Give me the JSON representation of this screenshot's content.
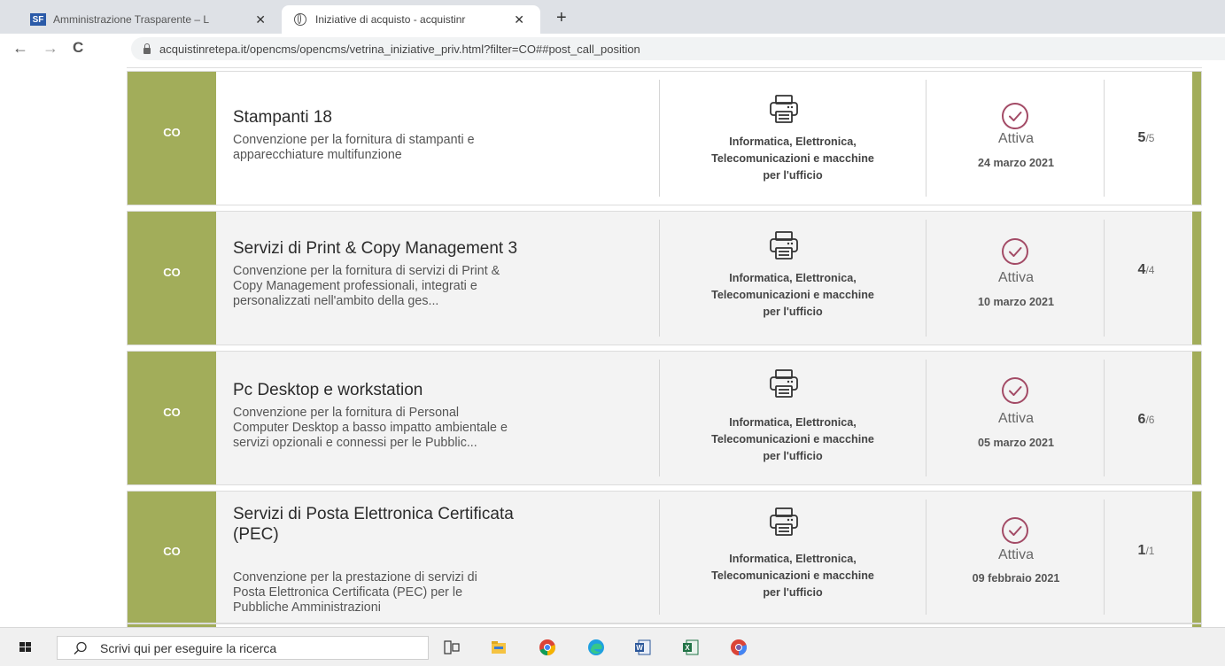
{
  "browser": {
    "tabs": [
      {
        "favicon": "SF",
        "label": "Amministrazione Trasparente – L"
      },
      {
        "favicon": "globe-icon",
        "label": "Iniziative di acquisto - acquistinr"
      }
    ],
    "tab_close": "✕",
    "new_tab": "+",
    "nav": {
      "back": "←",
      "forward": "→",
      "reload": "C"
    },
    "url": "acquistinretepa.it/opencms/opencms/vetrina_iniziative_priv.html?filter=CO##post_call_position"
  },
  "colors": {
    "accent": "#a2ad5a",
    "status_icon": "#a34b66"
  },
  "initiatives": [
    {
      "badge": "CO",
      "title_lines": [
        "Stampanti 18"
      ],
      "description_lines": [
        "Convenzione per la fornitura di stampanti e",
        "apparecchiature multifunzione"
      ],
      "category_icon": "printer-icon",
      "category_lines": [
        "Informatica, Elettronica,",
        "Telecomunicazioni e macchine",
        "per l'ufficio"
      ],
      "status_icon": "check-circle-icon",
      "status": "Attiva",
      "date": "24 marzo 2021",
      "lots_active": "5",
      "lots_total": "/5"
    },
    {
      "badge": "CO",
      "title_lines": [
        "Servizi di Print & Copy Management 3"
      ],
      "description_lines": [
        "Convenzione per la fornitura di servizi di Print &",
        "Copy Management professionali, integrati e",
        "personalizzati nell'ambito della ges..."
      ],
      "category_icon": "printer-icon",
      "category_lines": [
        "Informatica, Elettronica,",
        "Telecomunicazioni e macchine",
        "per l'ufficio"
      ],
      "status_icon": "check-circle-icon",
      "status": "Attiva",
      "date": "10 marzo 2021",
      "lots_active": "4",
      "lots_total": "/4"
    },
    {
      "badge": "CO",
      "title_lines": [
        "Pc Desktop e workstation"
      ],
      "description_lines": [
        "Convenzione per la fornitura di Personal",
        "Computer Desktop a basso impatto ambientale e",
        "servizi opzionali e connessi per le Pubblic..."
      ],
      "category_icon": "printer-icon",
      "category_lines": [
        "Informatica, Elettronica,",
        "Telecomunicazioni e macchine",
        "per l'ufficio"
      ],
      "status_icon": "check-circle-icon",
      "status": "Attiva",
      "date": "05 marzo 2021",
      "lots_active": "6",
      "lots_total": "/6"
    },
    {
      "badge": "CO",
      "title_lines": [
        "Servizi di Posta Elettronica Certificata",
        "(PEC)"
      ],
      "description_lines": [
        "Convenzione per la prestazione di servizi di",
        "Posta Elettronica Certificata (PEC) per le",
        "Pubbliche Amministrazioni"
      ],
      "category_icon": "printer-icon",
      "category_lines": [
        "Informatica, Elettronica,",
        "Telecomunicazioni e macchine",
        "per l'ufficio"
      ],
      "status_icon": "check-circle-icon",
      "status": "Attiva",
      "date": "09 febbraio 2021",
      "lots_active": "1",
      "lots_total": "/1"
    }
  ],
  "taskbar": {
    "search_placeholder": "Scrivi qui per eseguire la ricerca",
    "apps": [
      "task-view-icon",
      "file-explorer-icon",
      "chrome-icon",
      "edge-icon",
      "word-icon",
      "excel-icon",
      "chrome-alt-icon"
    ]
  }
}
